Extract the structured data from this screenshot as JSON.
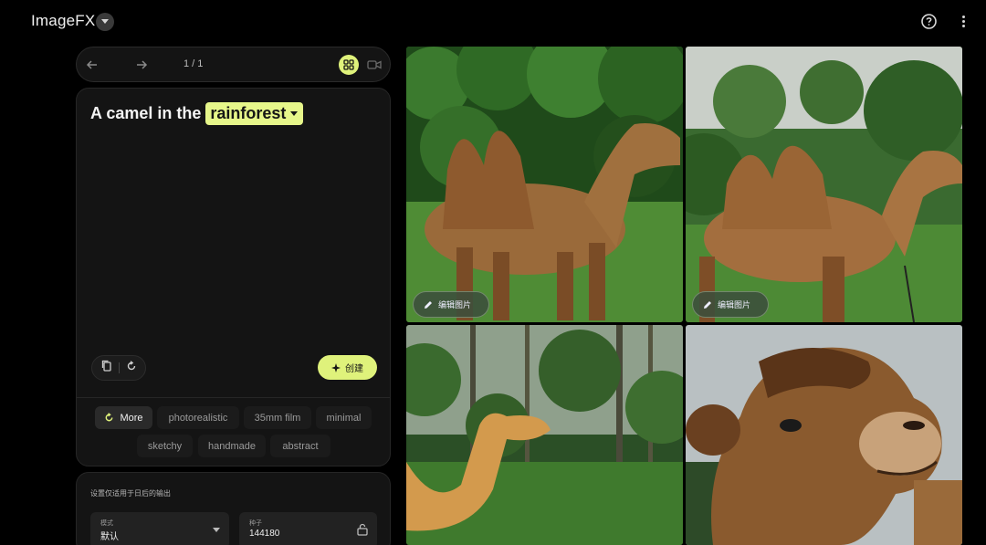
{
  "app": {
    "title": "ImageFX"
  },
  "pager": {
    "count": "1 / 1"
  },
  "prompt": {
    "text": "A camel in the",
    "chip": "rainforest"
  },
  "actions": {
    "create_label": "创建"
  },
  "styles": {
    "more_label": "More",
    "chips": [
      "photorealistic",
      "35mm film",
      "minimal",
      "sketchy",
      "handmade",
      "abstract"
    ]
  },
  "settings": {
    "note": "设置仅适用于日后的输出",
    "mode_label": "模式",
    "mode_value": "默认",
    "seed_label": "种子",
    "seed_value": "144180"
  },
  "images": {
    "edit_label": "编辑图片"
  },
  "colors": {
    "accent": "#dff27b",
    "background": "#000000",
    "card": "#141414"
  }
}
